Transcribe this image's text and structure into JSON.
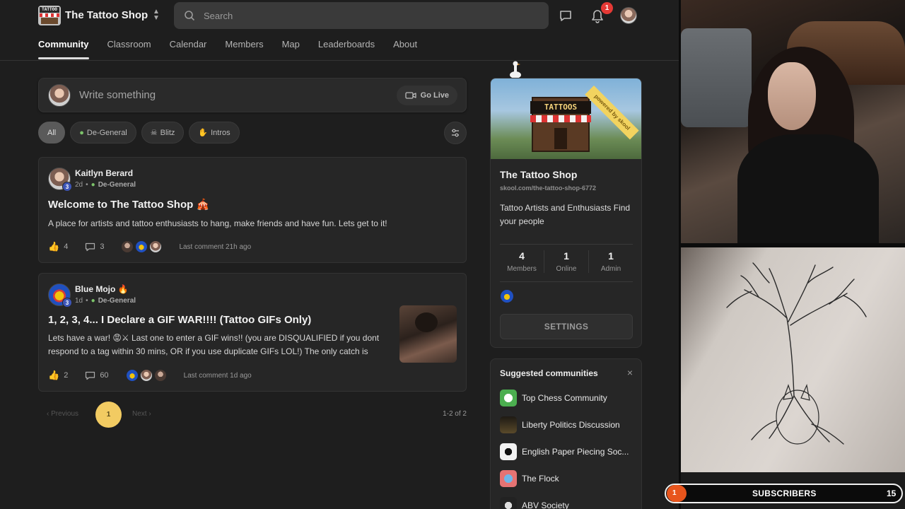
{
  "header": {
    "app_name": "The Tattoo Shop",
    "logo_text": "TATTOO",
    "search_placeholder": "Search",
    "notification_count": "1"
  },
  "nav": {
    "tabs": [
      {
        "label": "Community",
        "active": true
      },
      {
        "label": "Classroom"
      },
      {
        "label": "Calendar"
      },
      {
        "label": "Members"
      },
      {
        "label": "Map"
      },
      {
        "label": "Leaderboards"
      },
      {
        "label": "About"
      }
    ]
  },
  "composer": {
    "placeholder": "Write something",
    "go_live": "Go Live"
  },
  "filters": {
    "chips": [
      {
        "label": "All",
        "active": true
      },
      {
        "label": "De-General",
        "icon": "user-icon"
      },
      {
        "label": "Blitz",
        "icon": "skull-icon"
      },
      {
        "label": "Intros",
        "icon": "wave-hand-icon"
      }
    ]
  },
  "posts": [
    {
      "author": "Kaitlyn Berard",
      "level": "3",
      "time": "2d",
      "category": "De-General",
      "title": "Welcome to The Tattoo Shop 🎪",
      "body": "A place for artists and tattoo enthusiasts to hang, make friends and have fun. Lets get to it!",
      "likes": "4",
      "comments": "3",
      "last_comment": "Last comment 21h ago"
    },
    {
      "author": "Blue Mojo 🔥",
      "level": "3",
      "time": "1d",
      "category": "De-General",
      "title": "1, 2, 3, 4... I Declare a GIF WAR!!!! (Tattoo GIFs Only)",
      "body": "Lets have a war! 😡⚔ Last one to enter a GIF wins!! (you are DISQUALIFIED if you dont respond to a tag within 30 mins, OR if you use duplicate GIFs LOL!) The only catch is",
      "likes": "2",
      "comments": "60",
      "last_comment": "Last comment 1d ago"
    }
  ],
  "pagination": {
    "previous": "Previous",
    "current": "1",
    "next": "Next",
    "count": "1-2 of 2"
  },
  "group": {
    "banner_sign": "TATTOOS",
    "ribbon": "powered by skool",
    "name": "The Tattoo Shop",
    "url": "skool.com/the-tattoo-shop-6772",
    "description": "Tattoo Artists and Enthusiasts Find your people",
    "stats": [
      {
        "value": "4",
        "label": "Members"
      },
      {
        "value": "1",
        "label": "Online"
      },
      {
        "value": "1",
        "label": "Admin"
      }
    ],
    "settings_label": "SETTINGS"
  },
  "suggested": {
    "title": "Suggested communities",
    "items": [
      {
        "label": "Top Chess Community",
        "color": "#4caf50"
      },
      {
        "label": "Liberty Politics Discussion",
        "color": "#5a4a2a"
      },
      {
        "label": "English Paper Piecing Soc...",
        "color": "#f2f2f2"
      },
      {
        "label": "The Flock",
        "color": "#e57373"
      },
      {
        "label": "ABV Society",
        "color": "#222222"
      }
    ]
  },
  "stream": {
    "sub_goal_current": "1",
    "sub_label": "SUBSCRIBERS",
    "sub_goal_target": "15"
  },
  "colors": {
    "accent": "#f2cb62",
    "badge": "#e53935",
    "level_badge": "#3d55b8",
    "sub_accent": "#e8551c"
  }
}
